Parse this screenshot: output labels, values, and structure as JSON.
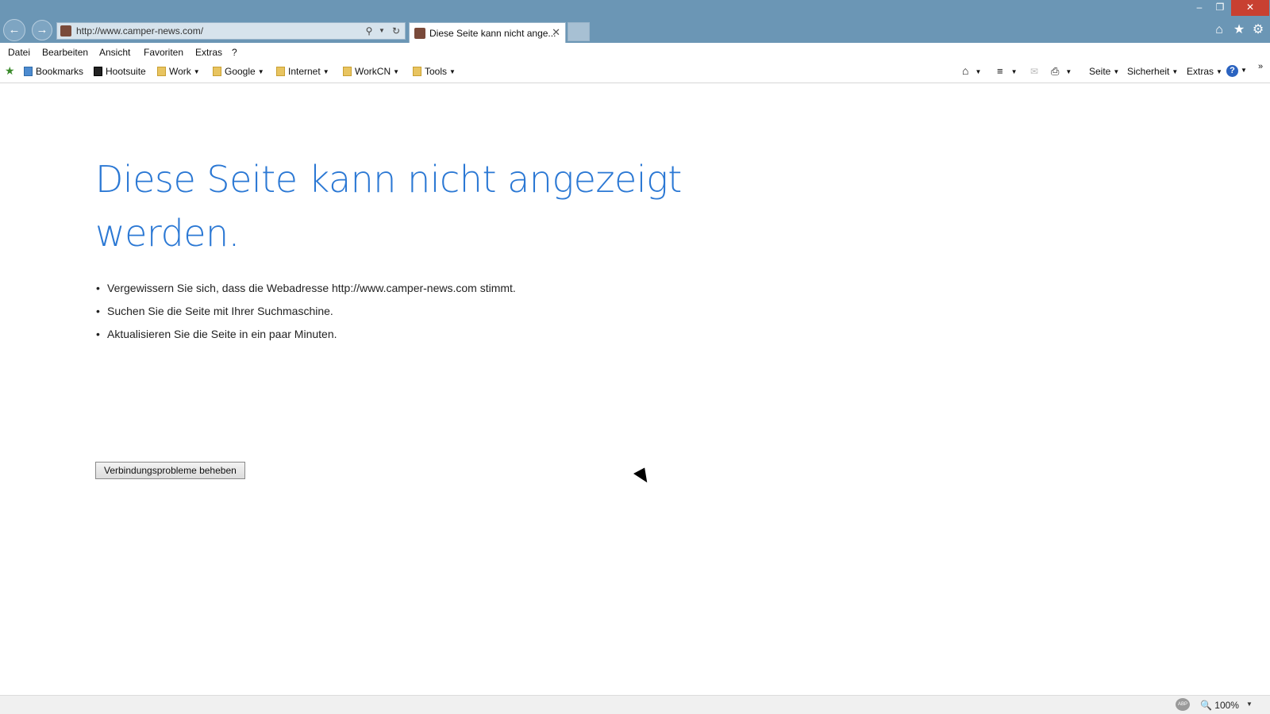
{
  "browser": {
    "address": "http://www.camper-news.com/",
    "tab_title": "Diese Seite kann nicht ange...",
    "tab_close": "✕",
    "window": {
      "minimize": "–",
      "maximize": "❐",
      "close": "✕"
    },
    "icons": {
      "home": "home-icon",
      "favorites": "star-icon",
      "tools": "gear-icon"
    }
  },
  "menu": {
    "items": [
      "Datei",
      "Bearbeiten",
      "Ansicht",
      "Favoriten",
      "Extras",
      "?"
    ]
  },
  "favorites_bar": {
    "items": [
      {
        "label": "Bookmarks"
      },
      {
        "label": "Hootsuite"
      },
      {
        "label": "Work"
      },
      {
        "label": "Google"
      },
      {
        "label": "Internet"
      },
      {
        "label": "WorkCN"
      },
      {
        "label": "Tools"
      }
    ],
    "commands": {
      "page": "Seite",
      "safety": "Sicherheit",
      "tools": "Extras"
    }
  },
  "content": {
    "heading": "Diese Seite kann nicht angezeigt werden.",
    "tips": [
      "Vergewissern Sie sich, dass die Webadresse http://www.camper-news.com stimmt.",
      "Suchen Sie die Seite mit Ihrer Suchmaschine.",
      "Aktualisieren Sie die Seite in ein paar Minuten."
    ],
    "fix_button": "Verbindungsprobleme beheben"
  },
  "status": {
    "zoom": "100%",
    "abp": "ABP"
  }
}
